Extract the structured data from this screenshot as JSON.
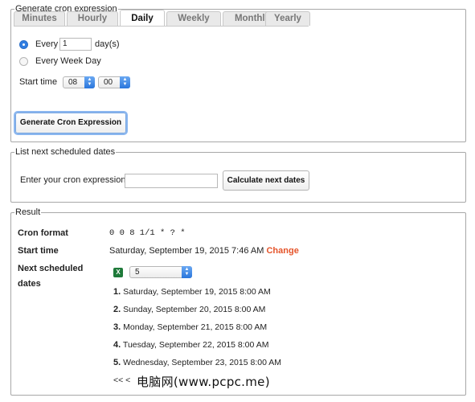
{
  "generate": {
    "legend": "Generate cron expression",
    "tabs": [
      {
        "label": "Minutes",
        "active": false
      },
      {
        "label": "Hourly",
        "active": false
      },
      {
        "label": "Daily",
        "active": true
      },
      {
        "label": "Weekly",
        "active": false
      },
      {
        "label": "Monthly",
        "active": false
      },
      {
        "label": "Yearly",
        "active": false
      }
    ],
    "every_label": "Every",
    "every_value": "1",
    "every_suffix": "day(s)",
    "every_week_day_label": "Every Week Day",
    "start_time_label": "Start time",
    "hour_value": "08",
    "minute_value": "00",
    "button_label": "Generate Cron Expression"
  },
  "list": {
    "legend": "List next scheduled dates",
    "prompt": "Enter your cron expression",
    "input_value": "",
    "button_label": "Calculate next dates"
  },
  "result": {
    "legend": "Result",
    "cron_format_label": "Cron format",
    "cron_format_value": "0 0 8 1/1 * ? *",
    "start_time_label": "Start time",
    "start_time_value": "Saturday, September 19, 2015 7:46 AM",
    "change_label": "Change",
    "next_label_line1": "Next scheduled",
    "next_label_line2": "dates",
    "count_value": "5",
    "dates": [
      {
        "num": "1.",
        "text": "Saturday, September 19, 2015 8:00 AM"
      },
      {
        "num": "2.",
        "text": "Sunday, September 20, 2015 8:00 AM"
      },
      {
        "num": "3.",
        "text": "Monday, September 21, 2015 8:00 AM"
      },
      {
        "num": "4.",
        "text": "Tuesday, September 22, 2015 8:00 AM"
      },
      {
        "num": "5.",
        "text": "Wednesday, September 23, 2015 8:00 AM"
      }
    ],
    "pager": "<< <"
  },
  "watermark": "电脑网(www.pcpc.me)",
  "colors": {
    "accent": "#2f7de1",
    "change": "#e5542a",
    "excel": "#1f7a3a"
  }
}
